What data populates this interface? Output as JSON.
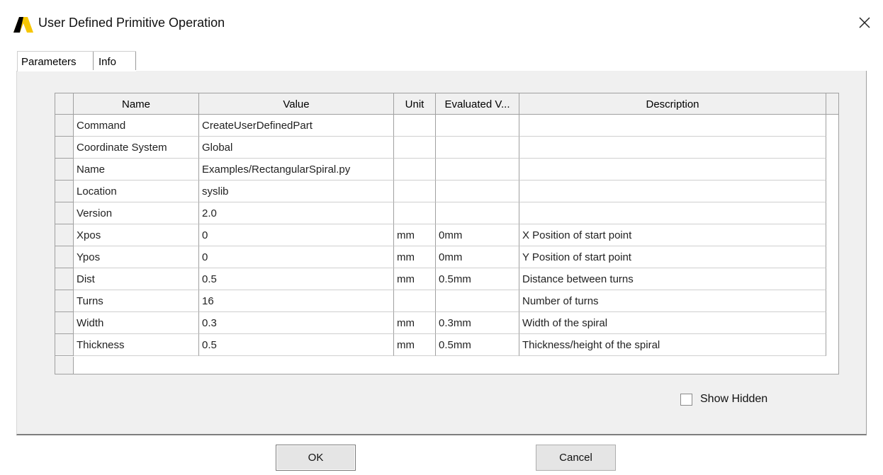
{
  "window": {
    "title": "User Defined Primitive Operation"
  },
  "tabs": [
    {
      "label": "Parameters"
    },
    {
      "label": "Info"
    }
  ],
  "table": {
    "columns": [
      "Name",
      "Value",
      "Unit",
      "Evaluated V...",
      "Description"
    ],
    "rows": [
      {
        "name": "Command",
        "value": "CreateUserDefinedPart",
        "unit": "",
        "evaluated": "",
        "description": ""
      },
      {
        "name": "Coordinate System",
        "value": "Global",
        "unit": "",
        "evaluated": "",
        "description": ""
      },
      {
        "name": "Name",
        "value": "Examples/RectangularSpiral.py",
        "unit": "",
        "evaluated": "",
        "description": ""
      },
      {
        "name": "Location",
        "value": "syslib",
        "unit": "",
        "evaluated": "",
        "description": ""
      },
      {
        "name": "Version",
        "value": "2.0",
        "unit": "",
        "evaluated": "",
        "description": ""
      },
      {
        "name": "Xpos",
        "value": "0",
        "unit": "mm",
        "evaluated": "0mm",
        "description": "X Position of start point"
      },
      {
        "name": "Ypos",
        "value": "0",
        "unit": "mm",
        "evaluated": "0mm",
        "description": "Y Position of start point"
      },
      {
        "name": "Dist",
        "value": "0.5",
        "unit": "mm",
        "evaluated": "0.5mm",
        "description": "Distance between turns"
      },
      {
        "name": "Turns",
        "value": "16",
        "unit": "",
        "evaluated": "",
        "description": "Number of turns"
      },
      {
        "name": "Width",
        "value": "0.3",
        "unit": "mm",
        "evaluated": "0.3mm",
        "description": "Width of the spiral"
      },
      {
        "name": "Thickness",
        "value": "0.5",
        "unit": "mm",
        "evaluated": "0.5mm",
        "description": "Thickness/height of the spiral"
      }
    ]
  },
  "show_hidden": {
    "label": "Show Hidden",
    "checked": false
  },
  "buttons": {
    "ok": "OK",
    "cancel": "Cancel"
  },
  "colors": {
    "logo_yellow": "#f7c600",
    "logo_black": "#000000"
  }
}
